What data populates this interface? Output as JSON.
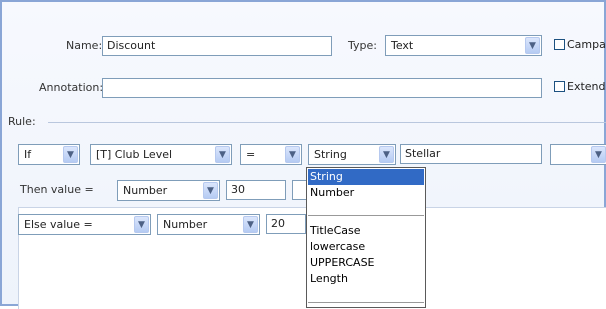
{
  "colors": {
    "accent": "#316ac5",
    "frame": "#8aa6d6",
    "field_border": "#7f9db9"
  },
  "header": {
    "name_label": "Name:",
    "name_value": "Discount",
    "type_label": "Type:",
    "type_value": "Text",
    "campaign_label": "Campa",
    "annotation_label": "Annotation:",
    "annotation_value": "",
    "extended_label": "Extend"
  },
  "rule": {
    "label": "Rule:",
    "if_row": {
      "condition": "If",
      "field": "[T] Club Level",
      "operator": "=",
      "value_type": "String",
      "value": "Stellar",
      "extra_select": ""
    },
    "then_row": {
      "label": "Then value =",
      "type": "Number",
      "value": "30"
    },
    "else_row": {
      "label": "Else value =",
      "type": "Number",
      "value": "20"
    }
  },
  "dropdown": {
    "options_top": [
      "String",
      "Number"
    ],
    "options_bottom": [
      "TitleCase",
      "lowercase",
      "UPPERCASE",
      "Length"
    ],
    "selected": "String"
  },
  "icons": {
    "select_arrow": "chevron-down-icon",
    "checkbox": "checkbox-icon"
  }
}
